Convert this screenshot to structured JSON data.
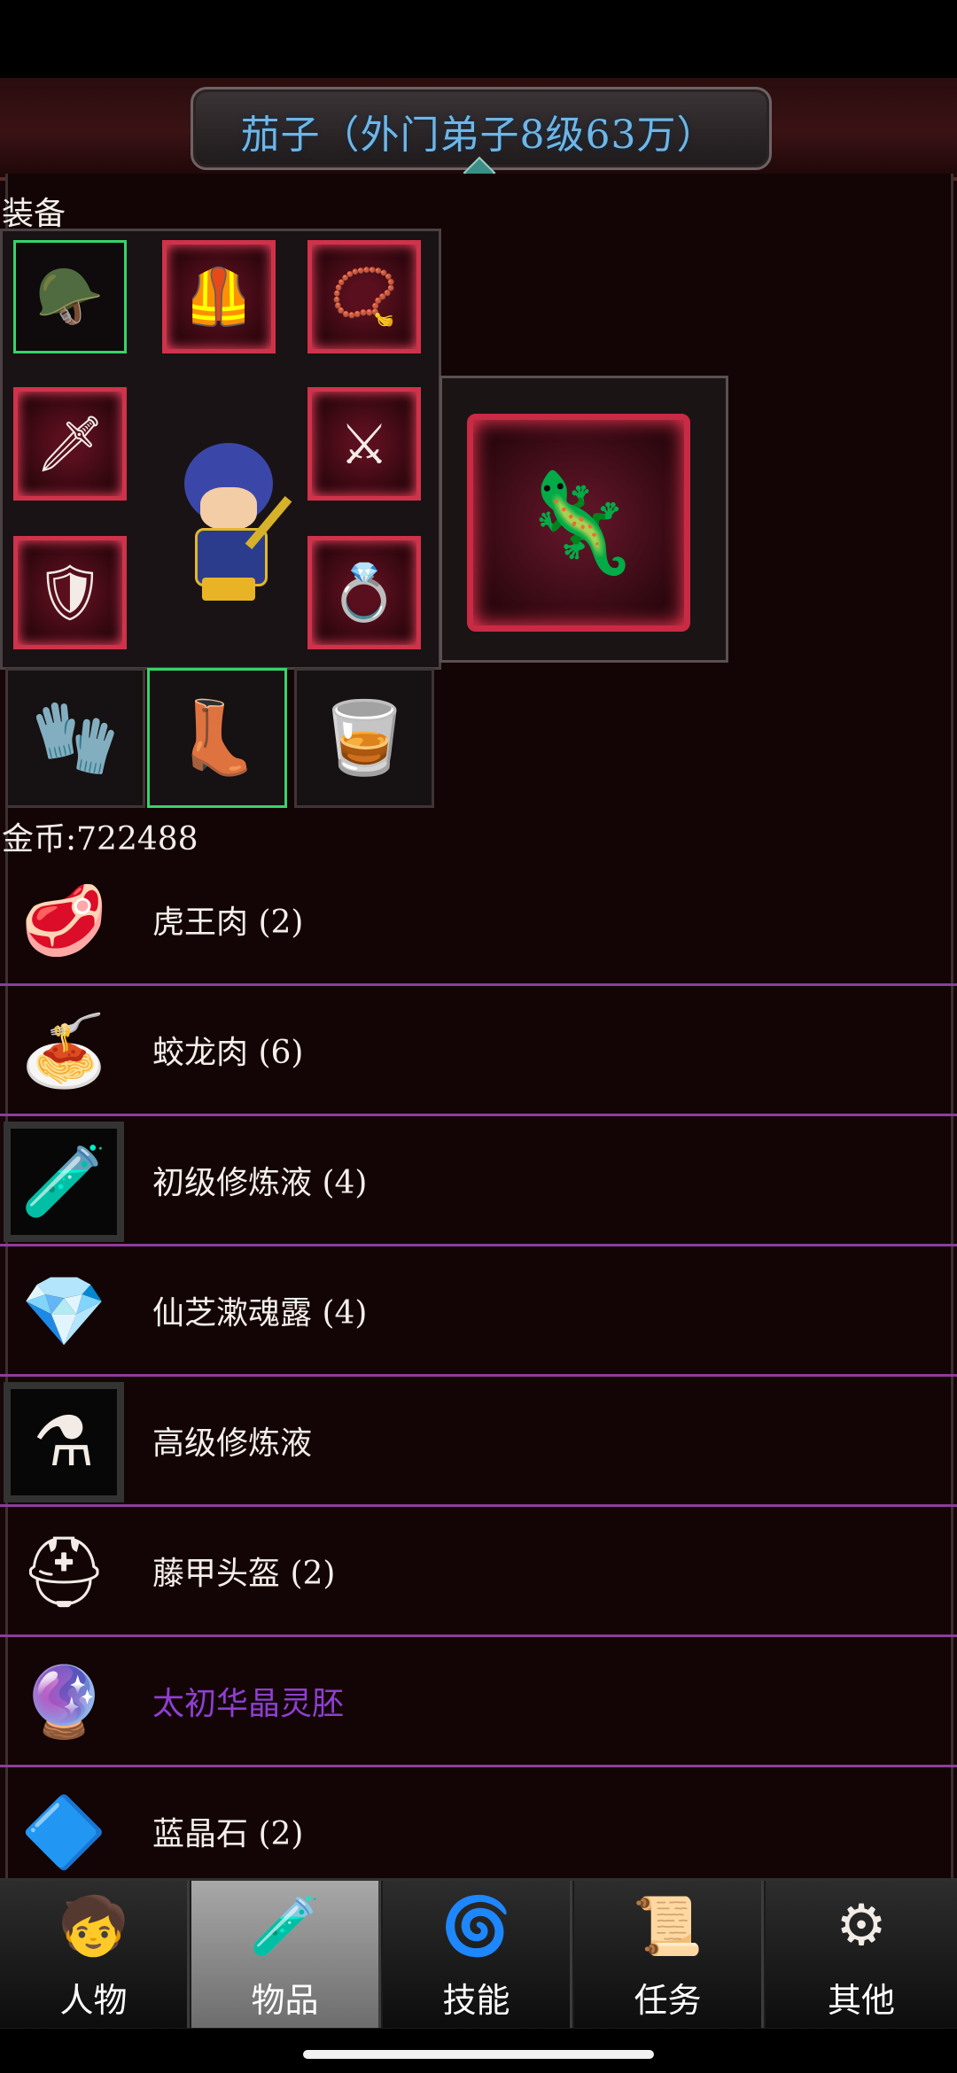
{
  "header": {
    "title": "茄子（外门弟子8级63万）"
  },
  "equipment": {
    "label": "装备",
    "slots": [
      {
        "name": "helmet",
        "icon": "🪖"
      },
      {
        "name": "armor",
        "icon": "🦺"
      },
      {
        "name": "necklace",
        "icon": "📿"
      },
      {
        "name": "staff",
        "icon": "🗡"
      },
      {
        "name": "sword",
        "icon": "⚔"
      },
      {
        "name": "shield",
        "icon": "🛡"
      },
      {
        "name": "gauntlet",
        "icon": "🧤"
      },
      {
        "name": "bracer",
        "icon": "🥃"
      },
      {
        "name": "boots",
        "icon": "👢"
      },
      {
        "name": "ring",
        "icon": "💍"
      },
      {
        "name": "mount",
        "icon": "🦎"
      }
    ]
  },
  "gold": {
    "text": "金币:722488"
  },
  "items": [
    {
      "name": "虎王肉 (2)",
      "icon": "🥩",
      "boxed": false,
      "purple": false
    },
    {
      "name": "蛟龙肉 (6)",
      "icon": "🍝",
      "boxed": false,
      "purple": false
    },
    {
      "name": "初级修炼液 (4)",
      "icon": "🧪",
      "boxed": true,
      "purple": false
    },
    {
      "name": "仙芝漱魂露 (4)",
      "icon": "💎",
      "boxed": false,
      "purple": false
    },
    {
      "name": "高级修炼液",
      "icon": "⚗",
      "boxed": true,
      "purple": false
    },
    {
      "name": "藤甲头盔 (2)",
      "icon": "⛑",
      "boxed": false,
      "purple": false
    },
    {
      "name": "太初华晶灵胚",
      "icon": "🔮",
      "boxed": false,
      "purple": true
    },
    {
      "name": "蓝晶石 (2)",
      "icon": "🔷",
      "boxed": false,
      "purple": false
    }
  ],
  "tabs": [
    {
      "label": "人物",
      "icon": "🧒",
      "active": false
    },
    {
      "label": "物品",
      "icon": "🧪",
      "active": true
    },
    {
      "label": "技能",
      "icon": "🌀",
      "active": false
    },
    {
      "label": "任务",
      "icon": "📜",
      "active": false
    },
    {
      "label": "其他",
      "icon": "⚙",
      "active": false
    }
  ],
  "colors": {
    "accent_title": "#6fb6e6",
    "divider": "#8d3e9a",
    "rare_item": "#8e3fd1",
    "active_tab": "#a8a8a8"
  }
}
